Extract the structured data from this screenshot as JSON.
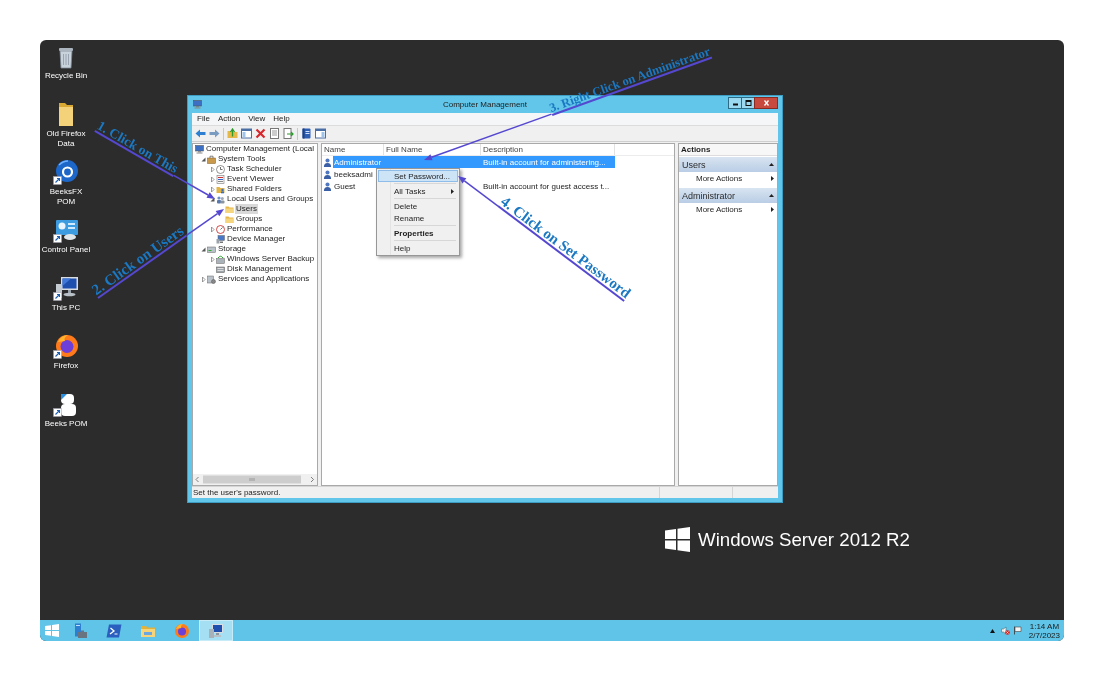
{
  "desktop_icons": [
    {
      "label": "Recycle Bin"
    },
    {
      "label": "Old Firefox Data"
    },
    {
      "label": "BeeksFX POM"
    },
    {
      "label": "Control Panel"
    },
    {
      "label": "This PC"
    },
    {
      "label": "Firefox"
    },
    {
      "label": "Beeks POM"
    }
  ],
  "window": {
    "title": "Computer Management",
    "menu": [
      "File",
      "Action",
      "View",
      "Help"
    ],
    "tree": [
      {
        "label": "Computer Management (Local",
        "selected": false,
        "children": [
          {
            "label": "System Tools",
            "expanded": true,
            "selected": false,
            "children": [
              {
                "label": "Task Scheduler",
                "expanded": false,
                "selected": false
              },
              {
                "label": "Event Viewer",
                "expanded": false,
                "selected": false
              },
              {
                "label": "Shared Folders",
                "expanded": false,
                "selected": false
              },
              {
                "label": "Local Users and Groups",
                "expanded": true,
                "selected": false,
                "children": [
                  {
                    "label": "Users",
                    "selected": true
                  },
                  {
                    "label": "Groups",
                    "selected": false
                  }
                ]
              },
              {
                "label": "Performance",
                "expanded": false,
                "selected": false
              },
              {
                "label": "Device Manager",
                "selected": false
              }
            ]
          },
          {
            "label": "Storage",
            "expanded": true,
            "selected": false,
            "children": [
              {
                "label": "Windows Server Backup",
                "expanded": false,
                "selected": false
              },
              {
                "label": "Disk Management",
                "selected": false
              }
            ]
          },
          {
            "label": "Services and Applications",
            "expanded": false,
            "selected": false
          }
        ]
      }
    ],
    "list": {
      "columns": [
        "Name",
        "Full Name",
        "Description"
      ],
      "rows": [
        {
          "name": "Administrator",
          "description": "Built-in account for administering...",
          "selected": true
        },
        {
          "name": "beeksadmi",
          "selected": false
        },
        {
          "name": "Guest",
          "description": "Built-in account for guest access t...",
          "selected": false
        }
      ]
    },
    "context_menu": [
      {
        "kind": "item",
        "label": "Set Password...",
        "selected": true
      },
      {
        "kind": "separator"
      },
      {
        "kind": "submenu",
        "label": "All Tasks",
        "selected": false
      },
      {
        "kind": "separator"
      },
      {
        "kind": "item",
        "label": "Delete",
        "selected": false
      },
      {
        "kind": "item",
        "label": "Rename",
        "selected": false
      },
      {
        "kind": "separator"
      },
      {
        "kind": "default",
        "label": "Properties",
        "selected": false
      },
      {
        "kind": "separator"
      },
      {
        "kind": "item",
        "label": "Help",
        "selected": false
      }
    ],
    "actions": {
      "title": "Actions",
      "sections": [
        {
          "title": "Users",
          "expanded": true,
          "items": [
            {
              "label": "More Actions"
            }
          ]
        },
        {
          "title": "Administrator",
          "expanded": true,
          "items": [
            {
              "label": "More Actions"
            }
          ]
        }
      ]
    },
    "status_bar": "Set the user's password."
  },
  "annotations": [
    {
      "text": "1. Click on This"
    },
    {
      "text": "2. Click on Users"
    },
    {
      "text": "3. Right Click on Administrator"
    },
    {
      "text": "4. Click on Set Password"
    }
  ],
  "branding": "Windows Server 2012 R2",
  "taskbar": {
    "apps": [
      {
        "selected": false
      },
      {
        "selected": false
      },
      {
        "selected": false
      },
      {
        "selected": false
      },
      {
        "selected": true
      }
    ],
    "clock": {
      "time": "1:14 AM",
      "date": "2/7/2023"
    }
  }
}
